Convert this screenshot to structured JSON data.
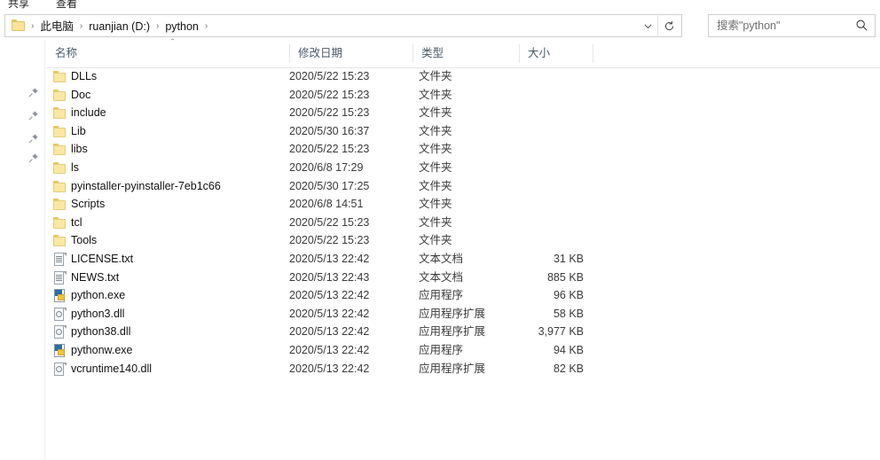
{
  "ribbon": {
    "tabs": [
      {
        "label": "共享"
      },
      {
        "label": "查看"
      }
    ]
  },
  "addressbar": {
    "folder_icon": "folder-icon",
    "breadcrumbs": [
      {
        "label": "此电脑"
      },
      {
        "label": "ruanjian (D:)"
      },
      {
        "label": "python"
      }
    ],
    "separator": "›",
    "dropdown_icon": "chevron-down-icon",
    "refresh_icon": "refresh-icon"
  },
  "search": {
    "placeholder": "搜索\"python\"",
    "icon": "search-icon"
  },
  "nav_pane": {
    "pin_icon": "pin-icon",
    "pin_count": 4
  },
  "columns": [
    {
      "key": "name",
      "label": "名称",
      "sorted": true,
      "sort_direction": "ascending",
      "sort_caret": "＾"
    },
    {
      "key": "date",
      "label": "修改日期"
    },
    {
      "key": "type",
      "label": "类型"
    },
    {
      "key": "size",
      "label": "大小"
    }
  ],
  "files": [
    {
      "name": "DLLs",
      "date": "2020/5/22 15:23",
      "type": "文件夹",
      "size": "",
      "icon": "folder-icon"
    },
    {
      "name": "Doc",
      "date": "2020/5/22 15:23",
      "type": "文件夹",
      "size": "",
      "icon": "folder-icon"
    },
    {
      "name": "include",
      "date": "2020/5/22 15:23",
      "type": "文件夹",
      "size": "",
      "icon": "folder-icon"
    },
    {
      "name": "Lib",
      "date": "2020/5/30 16:37",
      "type": "文件夹",
      "size": "",
      "icon": "folder-icon"
    },
    {
      "name": "libs",
      "date": "2020/5/22 15:23",
      "type": "文件夹",
      "size": "",
      "icon": "folder-icon"
    },
    {
      "name": "ls",
      "date": "2020/6/8 17:29",
      "type": "文件夹",
      "size": "",
      "icon": "folder-icon"
    },
    {
      "name": "pyinstaller-pyinstaller-7eb1c66",
      "date": "2020/5/30 17:25",
      "type": "文件夹",
      "size": "",
      "icon": "folder-icon"
    },
    {
      "name": "Scripts",
      "date": "2020/6/8 14:51",
      "type": "文件夹",
      "size": "",
      "icon": "folder-icon"
    },
    {
      "name": "tcl",
      "date": "2020/5/22 15:23",
      "type": "文件夹",
      "size": "",
      "icon": "folder-icon"
    },
    {
      "name": "Tools",
      "date": "2020/5/22 15:23",
      "type": "文件夹",
      "size": "",
      "icon": "folder-icon"
    },
    {
      "name": "LICENSE.txt",
      "date": "2020/5/13 22:42",
      "type": "文本文档",
      "size": "31 KB",
      "icon": "text-document-icon"
    },
    {
      "name": "NEWS.txt",
      "date": "2020/5/13 22:43",
      "type": "文本文档",
      "size": "885 KB",
      "icon": "text-document-icon"
    },
    {
      "name": "python.exe",
      "date": "2020/5/13 22:42",
      "type": "应用程序",
      "size": "96 KB",
      "icon": "application-icon"
    },
    {
      "name": "python3.dll",
      "date": "2020/5/13 22:42",
      "type": "应用程序扩展",
      "size": "58 KB",
      "icon": "dll-icon"
    },
    {
      "name": "python38.dll",
      "date": "2020/5/13 22:42",
      "type": "应用程序扩展",
      "size": "3,977 KB",
      "icon": "dll-icon"
    },
    {
      "name": "pythonw.exe",
      "date": "2020/5/13 22:42",
      "type": "应用程序",
      "size": "94 KB",
      "icon": "application-icon"
    },
    {
      "name": "vcruntime140.dll",
      "date": "2020/5/13 22:42",
      "type": "应用程序扩展",
      "size": "82 KB",
      "icon": "dll-icon"
    }
  ],
  "colors": {
    "folder": "#fbe7a4",
    "folder_edge": "#e6cd78",
    "header_text": "#4a5a6a",
    "border": "#cfcfcf"
  }
}
